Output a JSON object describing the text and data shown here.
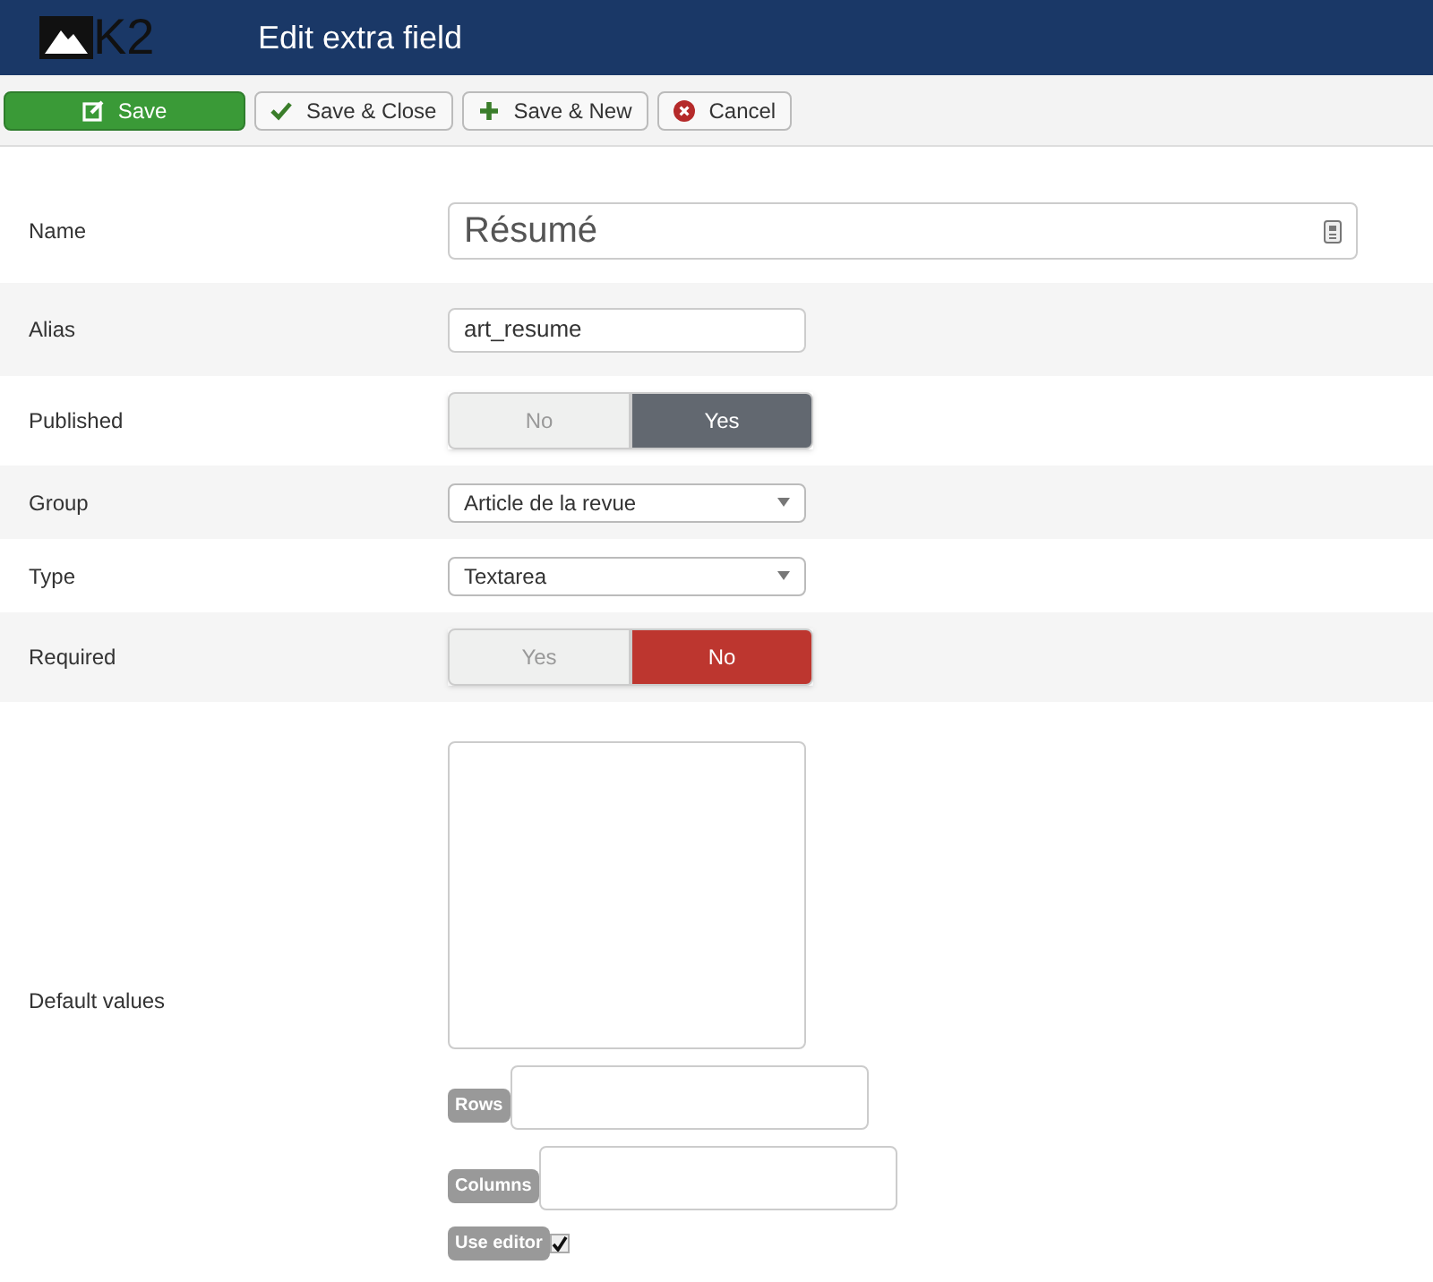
{
  "header": {
    "logo": "K2",
    "title": "Edit extra field"
  },
  "toolbar": [
    {
      "kind": "save",
      "label": "Save"
    },
    {
      "kind": "check",
      "label": "Save & Close"
    },
    {
      "kind": "plus",
      "label": "Save & New"
    },
    {
      "kind": "cancel",
      "label": "Cancel"
    }
  ],
  "fields": [
    {
      "kind": "title",
      "label": "Name",
      "value": "Résumé"
    },
    {
      "kind": "text",
      "label": "Alias",
      "value": "art_resume"
    },
    {
      "kind": "toggle",
      "label": "Published",
      "danger": false,
      "options": [
        {
          "label": "No",
          "selected": false
        },
        {
          "label": "Yes",
          "selected": true
        }
      ]
    },
    {
      "kind": "select",
      "label": "Group",
      "value": "Article de la revue"
    },
    {
      "kind": "select",
      "label": "Type",
      "value": "Textarea"
    },
    {
      "kind": "toggle",
      "label": "Required",
      "danger": true,
      "options": [
        {
          "label": "Yes",
          "selected": false
        },
        {
          "label": "No",
          "selected": true
        }
      ]
    },
    {
      "kind": "textarea",
      "label": "Default values",
      "rows_label": "Rows",
      "columns_label": "Columns",
      "editor_label": "Use editor",
      "use_editor": true
    }
  ]
}
